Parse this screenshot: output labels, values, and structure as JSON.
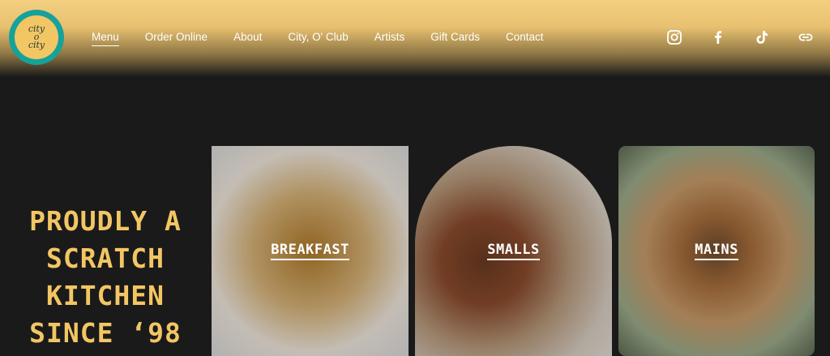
{
  "logo": {
    "line1": "city",
    "line2": "o",
    "line3": "city"
  },
  "nav": {
    "items": [
      "Menu",
      "Order Online",
      "About",
      "City, O' Club",
      "Artists",
      "Gift Cards",
      "Contact"
    ]
  },
  "social": [
    "instagram-icon",
    "facebook-icon",
    "tiktok-icon",
    "link-icon"
  ],
  "hero": {
    "headline_lines": [
      "PROUDLY A",
      "SCRATCH",
      "KITCHEN",
      "SINCE ‘98"
    ]
  },
  "cards": [
    "BREAKFAST",
    "SMALLS",
    "MAINS"
  ],
  "colors": {
    "accent": "#f3c664",
    "teal": "#16a29a",
    "background": "#1a1a1a"
  }
}
